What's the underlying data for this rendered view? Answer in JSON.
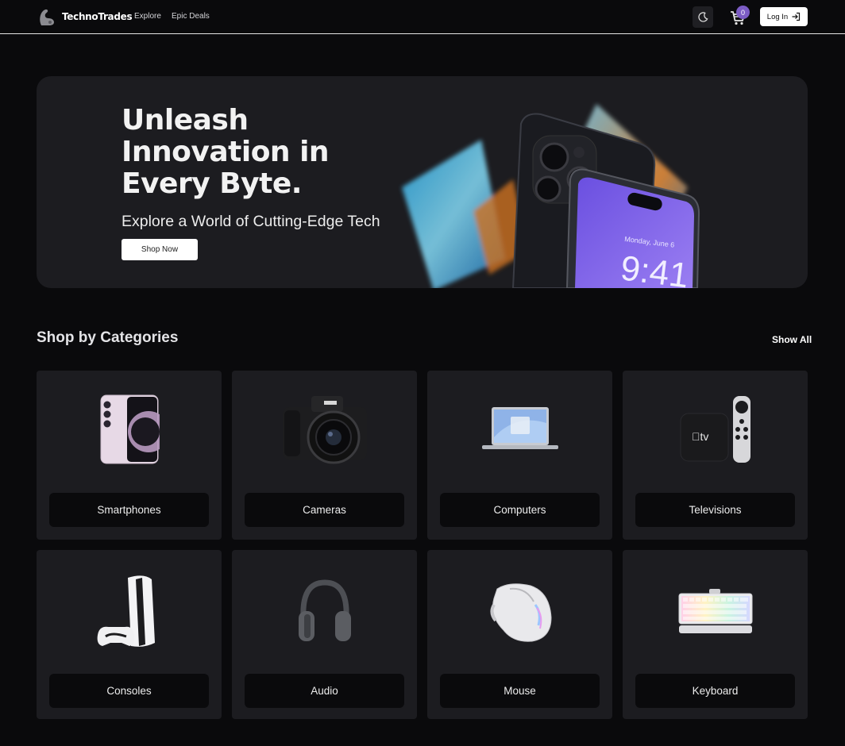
{
  "nav": {
    "brand": "TechnoTrades",
    "links": [
      "Explore",
      "Epic Deals"
    ],
    "cart_count": "0",
    "login_label": "Log In"
  },
  "hero": {
    "title_lines": [
      "Unleash",
      "Innovation in",
      "Every Byte."
    ],
    "subtitle": "Explore a World of Cutting-Edge Tech",
    "cta_label": "Shop Now",
    "phone_date": "Monday, June 6",
    "phone_time": "9:41"
  },
  "categories": {
    "title": "Shop by Categories",
    "show_all_label": "Show All",
    "items": [
      {
        "label": "Smartphones",
        "icon": "smartphone-icon"
      },
      {
        "label": "Cameras",
        "icon": "camera-icon"
      },
      {
        "label": "Computers",
        "icon": "laptop-icon"
      },
      {
        "label": "Televisions",
        "icon": "tv-box-icon"
      },
      {
        "label": "Consoles",
        "icon": "console-icon"
      },
      {
        "label": "Audio",
        "icon": "headphones-icon"
      },
      {
        "label": "Mouse",
        "icon": "mouse-icon"
      },
      {
        "label": "Keyboard",
        "icon": "keyboard-icon"
      }
    ]
  },
  "colors": {
    "background": "#0a0a0c",
    "card": "#1c1c20",
    "accent": "#7c5cc4"
  }
}
